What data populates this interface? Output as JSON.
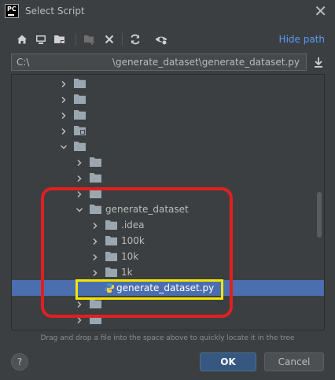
{
  "window": {
    "title": "Select Script",
    "logo_text": "PC",
    "close_glyph": "✕"
  },
  "toolbar": {
    "icons": [
      "home-icon",
      "desktop-icon",
      "project-folder-icon",
      "new-folder-icon",
      "delete-icon",
      "refresh-icon",
      "show-hidden-icon"
    ],
    "hide_path_label": "Hide path"
  },
  "path": {
    "drive": "C:\\",
    "value": "\\generate_dataset\\generate_dataset.py"
  },
  "tree": {
    "rows": [
      {
        "label": "",
        "expanded": false,
        "kind": "folder",
        "depth": 0
      },
      {
        "label": "",
        "expanded": false,
        "kind": "folder",
        "depth": 0
      },
      {
        "label": "",
        "expanded": false,
        "kind": "folder",
        "depth": 0
      },
      {
        "label": "",
        "expanded": false,
        "kind": "folder-special",
        "depth": 0
      },
      {
        "label": "",
        "expanded": true,
        "kind": "folder",
        "depth": 0
      },
      {
        "label": "",
        "expanded": false,
        "kind": "folder",
        "depth": 1
      },
      {
        "label": "",
        "expanded": false,
        "kind": "folder",
        "depth": 1
      },
      {
        "label": "",
        "expanded": false,
        "kind": "folder",
        "depth": 1
      },
      {
        "label": "generate_dataset",
        "expanded": true,
        "kind": "folder",
        "depth": 1
      },
      {
        "label": ".idea",
        "expanded": false,
        "kind": "folder",
        "depth": 2
      },
      {
        "label": "100k",
        "expanded": false,
        "kind": "folder",
        "depth": 2
      },
      {
        "label": "10k",
        "expanded": false,
        "kind": "folder",
        "depth": 2
      },
      {
        "label": "1k",
        "expanded": false,
        "kind": "folder",
        "depth": 2
      },
      {
        "label": "generate_dataset.py",
        "kind": "python-file",
        "depth": 3,
        "selected": true
      },
      {
        "label": "",
        "expanded": false,
        "kind": "folder",
        "depth": 1
      },
      {
        "label": "",
        "expanded": false,
        "kind": "folder",
        "depth": 1
      }
    ]
  },
  "hint": "Drag and drop a file into the space above to quickly locate it in the tree",
  "buttons": {
    "help": "?",
    "ok": "OK",
    "cancel": "Cancel"
  },
  "colors": {
    "accent": "#589df6",
    "selection": "#4b6eaf",
    "highlight_red": "#e02020",
    "highlight_yellow": "#f2e600"
  }
}
